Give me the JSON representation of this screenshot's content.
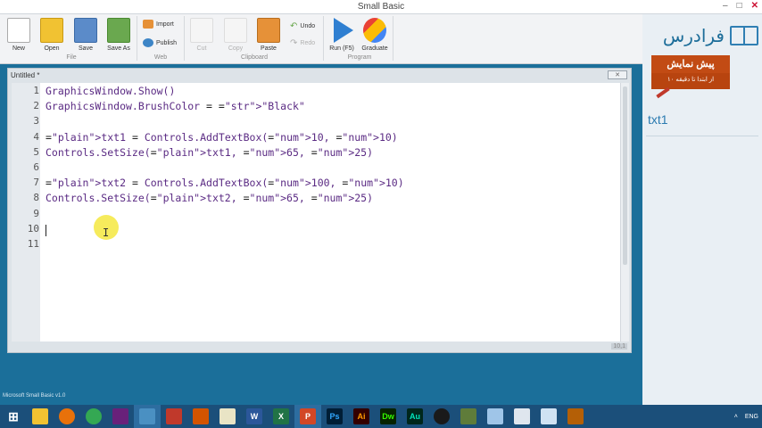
{
  "window": {
    "title": "Small Basic",
    "app_status": "Microsoft Small Basic v1.0"
  },
  "ribbon": {
    "file": {
      "group": "File",
      "new": "New",
      "open": "Open",
      "save": "Save",
      "save_as": "Save As"
    },
    "web": {
      "group": "Web",
      "import": "Import",
      "publish": "Publish"
    },
    "clipboard": {
      "group": "Clipboard",
      "cut": "Cut",
      "copy": "Copy",
      "paste": "Paste",
      "undo": "Undo",
      "redo": "Redo"
    },
    "program": {
      "group": "Program",
      "run": "Run (F5)",
      "graduate": "Graduate"
    }
  },
  "editor": {
    "tab_title": "Untitled *",
    "lines": [
      {
        "num": "1",
        "text": "GraphicsWindow.Show()"
      },
      {
        "num": "2",
        "text": "GraphicsWindow.BrushColor = \"Black\""
      },
      {
        "num": "3",
        "text": ""
      },
      {
        "num": "4",
        "text": "txt1 = Controls.AddTextBox(10, 10)"
      },
      {
        "num": "5",
        "text": "Controls.SetSize(txt1, 65, 25)"
      },
      {
        "num": "6",
        "text": ""
      },
      {
        "num": "7",
        "text": "txt2 = Controls.AddTextBox(100, 10)"
      },
      {
        "num": "8",
        "text": "Controls.SetSize(txt2, 65, 25)"
      },
      {
        "num": "9",
        "text": ""
      },
      {
        "num": "10",
        "text": ""
      },
      {
        "num": "11",
        "text": ""
      }
    ],
    "cursor_pos": "10,1"
  },
  "sidebar": {
    "logo_text": "فرادرس",
    "promo_title": "پیش نمایش",
    "promo_sub": "از ابتدا تا دقیقه ۱۰",
    "help_word": "txt1"
  },
  "tray": {
    "lang": "ENG"
  },
  "colors": {
    "accent": "#1b6f9a",
    "keyword": "#5a2a83",
    "string": "#b0392b",
    "taskbar": "#1b4f7a"
  }
}
